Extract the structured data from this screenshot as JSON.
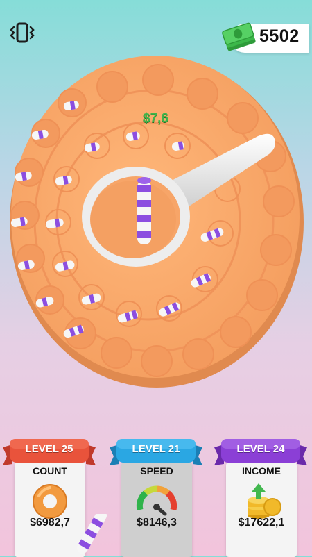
{
  "hud": {
    "cash": "5502",
    "icons": {
      "vibrate": "vibrate-phone-icon",
      "cash": "cash-stack-icon"
    }
  },
  "game": {
    "popup_earning": "$7,6",
    "colors": {
      "board": "#f6a66a",
      "board_dark": "#e9874e",
      "ring": "#f0f0f0",
      "stripe_purple": "#8c4ee0",
      "stripe_white": "#f6f6f6"
    }
  },
  "upgrades": [
    {
      "level": "LEVEL 25",
      "label": "COUNT",
      "price": "$6982,7",
      "icon": "donut-ring-icon",
      "ribbon_color": "#e9533b"
    },
    {
      "level": "LEVEL 21",
      "label": "SPEED",
      "price": "$8146,3",
      "icon": "speedometer-icon",
      "ribbon_color": "#2aa7e3"
    },
    {
      "level": "LEVEL 24",
      "label": "INCOME",
      "price": "$17622,1",
      "icon": "coins-growth-icon",
      "ribbon_color": "#8b3fd6"
    }
  ]
}
